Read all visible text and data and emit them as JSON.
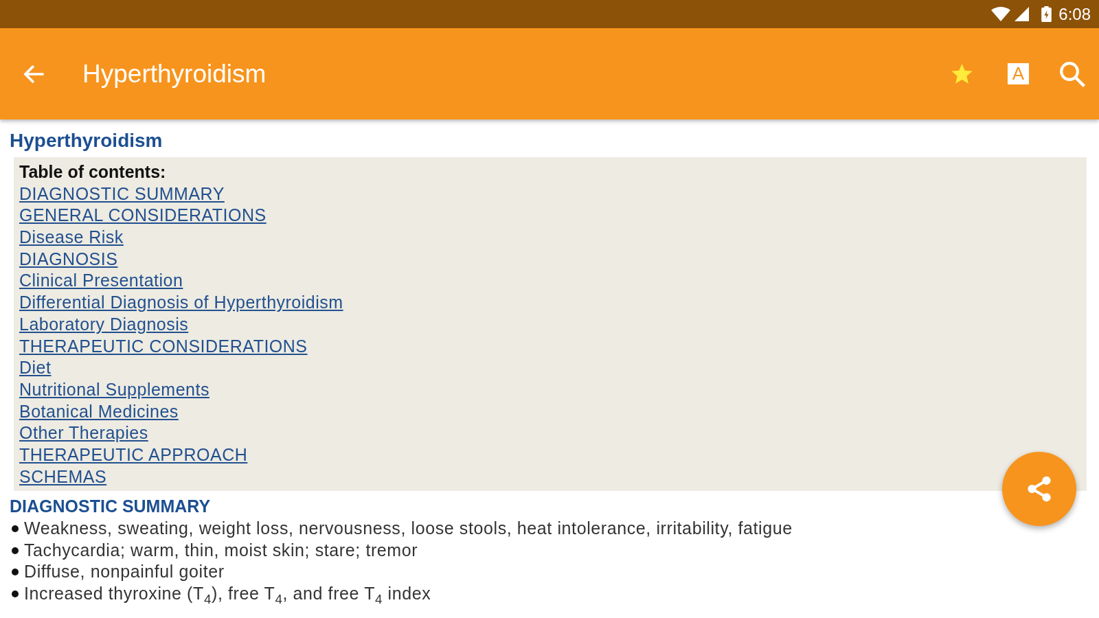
{
  "status_bar": {
    "time": "6:08"
  },
  "app_bar": {
    "title": "Hyperthyroidism",
    "favorite": true,
    "text_size_glyph": "A"
  },
  "article": {
    "title": "Hyperthyroidism",
    "toc": {
      "heading": "Table of contents:",
      "links": [
        "DIAGNOSTIC SUMMARY",
        "GENERAL CONSIDERATIONS",
        "Disease Risk",
        "DIAGNOSIS",
        "Clinical Presentation",
        "Differential Diagnosis of Hyperthyroidism",
        "Laboratory Diagnosis",
        "THERAPEUTIC CONSIDERATIONS",
        "Diet",
        "Nutritional Supplements",
        "Botanical Medicines",
        "Other Therapies",
        "THERAPEUTIC APPROACH",
        "SCHEMAS"
      ]
    },
    "sections": [
      {
        "heading": "DIAGNOSTIC SUMMARY",
        "bullets": [
          "Weakness, sweating, weight loss, nervousness, loose stools, heat intolerance, irritability, fatigue",
          "Tachycardia; warm, thin, moist skin; stare; tremor",
          "Diffuse, nonpainful goiter",
          "Increased thyroxine (T$_{4}$), free T$_{4}$, and free T$_{4}$ index"
        ]
      }
    ]
  }
}
